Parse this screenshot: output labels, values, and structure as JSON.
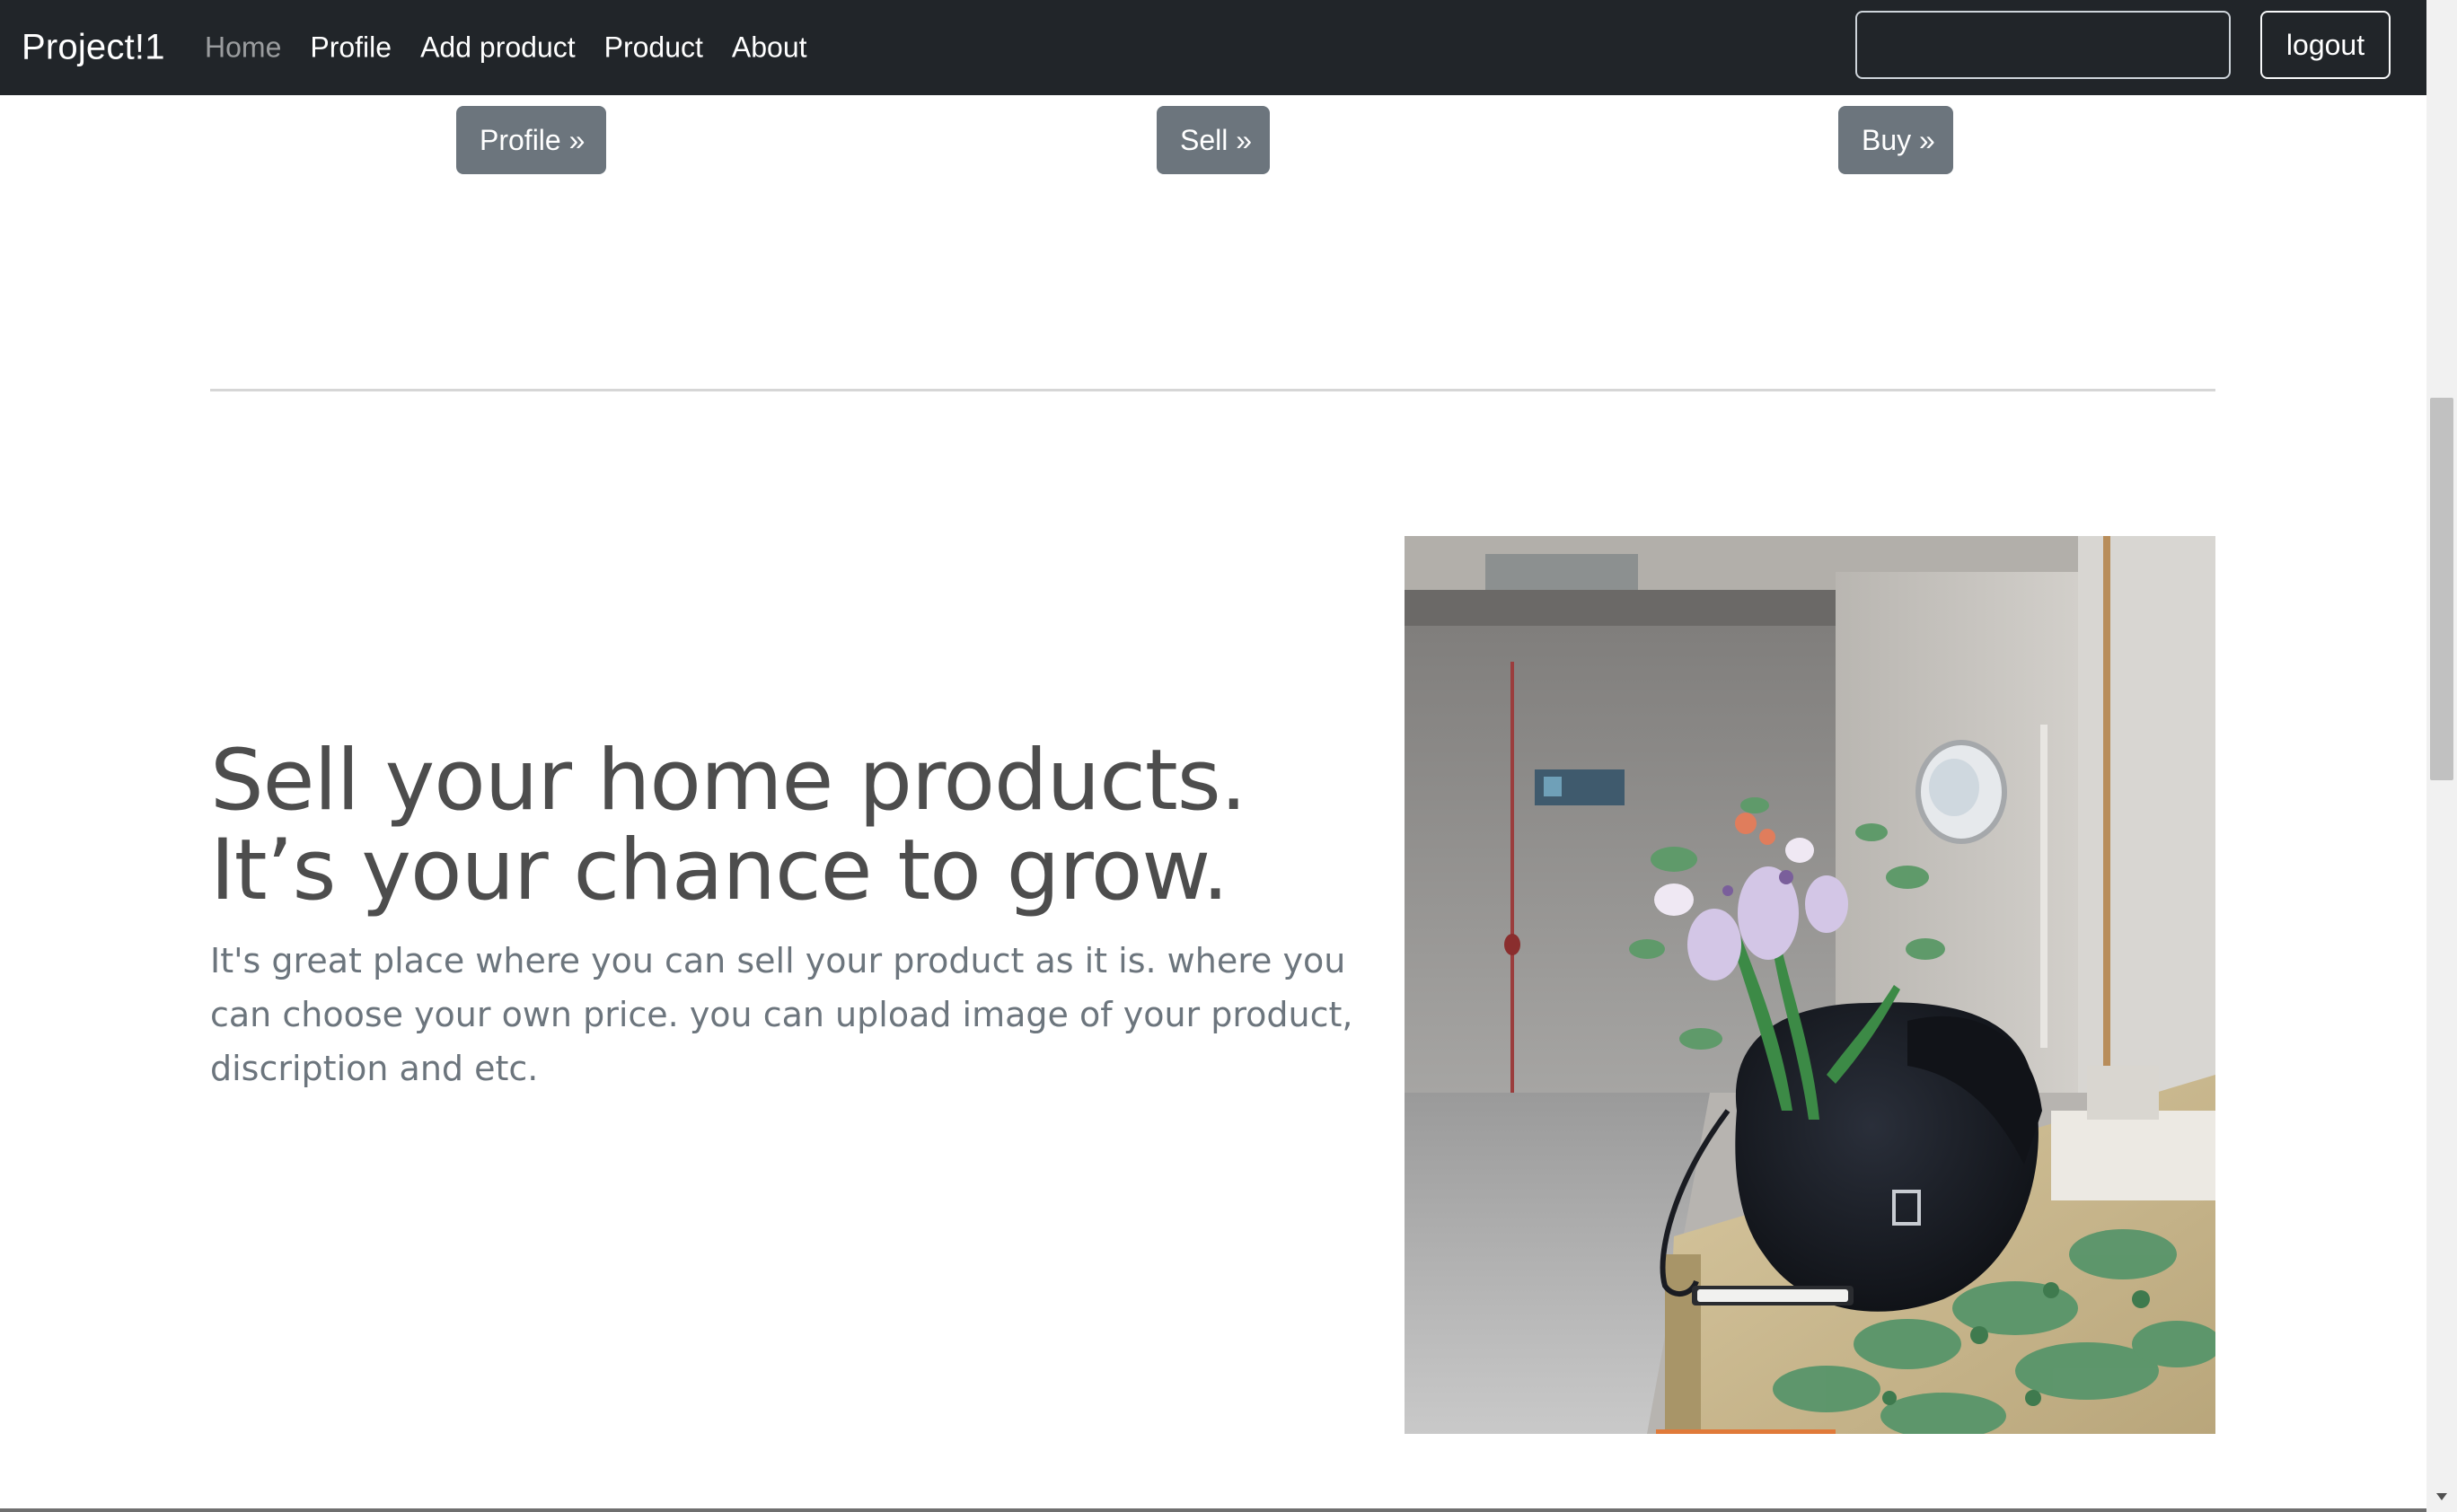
{
  "navbar": {
    "brand": "Project!1",
    "links": [
      {
        "label": "Home",
        "active": true
      },
      {
        "label": "Profile",
        "active": false
      },
      {
        "label": "Add product",
        "active": false
      },
      {
        "label": "Product",
        "active": false
      },
      {
        "label": "About",
        "active": false
      }
    ],
    "search": {
      "value": "",
      "placeholder": ""
    },
    "logout_label": "logout"
  },
  "features": {
    "profile_button": "Profile »",
    "sell_button": "Sell »",
    "buy_button": "Buy »"
  },
  "featurette": {
    "heading": "Sell your home products. It’s your chance to grow.",
    "lead": "It's great place where you can sell your product as it is. where you can choose your own price. you can upload image of your product, discription and etc.",
    "image_alt": "flowers in a black bag on a counter"
  },
  "colors": {
    "navbar_bg": "#212529",
    "button_gray": "#6c757d",
    "heading_text": "#4d4d4d",
    "lead_text": "#6c757d"
  }
}
